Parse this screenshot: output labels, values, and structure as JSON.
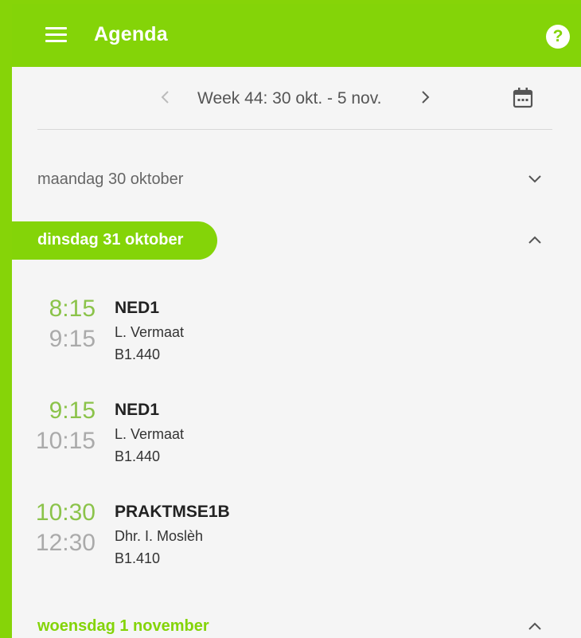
{
  "app": {
    "title": "Agenda",
    "help_label": "?"
  },
  "week": {
    "label": "Week 44: 30 okt. - 5 nov."
  },
  "days": [
    {
      "label": "maandag 30 oktober"
    },
    {
      "label": "dinsdag 31 oktober"
    },
    {
      "label": "woensdag 1 november"
    }
  ],
  "lessons": [
    {
      "start": "8:15",
      "end": "9:15",
      "subject": "NED1",
      "teacher": "L. Vermaat",
      "room": "B1.440"
    },
    {
      "start": "9:15",
      "end": "10:15",
      "subject": "NED1",
      "teacher": "L. Vermaat",
      "room": "B1.440"
    },
    {
      "start": "10:30",
      "end": "12:30",
      "subject": "PRAKTMSE1B",
      "teacher": "Dhr. I. Moslèh",
      "room": "B1.410"
    }
  ],
  "colors": {
    "accent": "#84d408",
    "time_start": "#8bc34a",
    "time_end": "#aaaaaa"
  },
  "icons": [
    "menu-icon",
    "help-icon",
    "chevron-left-icon",
    "chevron-right-icon",
    "calendar-icon",
    "chevron-down-icon",
    "chevron-up-icon"
  ]
}
